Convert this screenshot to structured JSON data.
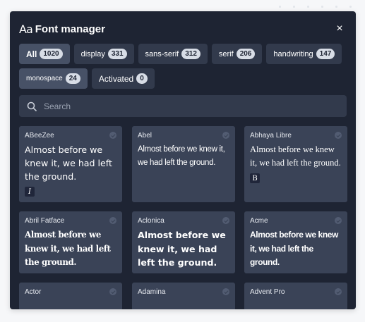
{
  "header": {
    "title_icon": "Aa",
    "title": "Font manager",
    "close_icon": "×"
  },
  "filters": [
    {
      "label": "All",
      "count": "1020"
    },
    {
      "label": "display",
      "count": "331"
    },
    {
      "label": "sans-serif",
      "count": "312"
    },
    {
      "label": "serif",
      "count": "206"
    },
    {
      "label": "handwriting",
      "count": "147"
    },
    {
      "label": "monospace",
      "count": "24"
    },
    {
      "label": "Activated",
      "count": "0"
    }
  ],
  "search": {
    "placeholder": "Search"
  },
  "sample_text": "Almost before we knew it, we had left the ground.",
  "fonts": [
    {
      "name": "ABeeZee",
      "tag": "I"
    },
    {
      "name": "Abel",
      "tag": ""
    },
    {
      "name": "Abhaya Libre",
      "tag": "B"
    },
    {
      "name": "Abril Fatface",
      "tag": ""
    },
    {
      "name": "Aclonica",
      "tag": ""
    },
    {
      "name": "Acme",
      "tag": ""
    },
    {
      "name": "Actor",
      "tag": ""
    },
    {
      "name": "Adamina",
      "tag": ""
    },
    {
      "name": "Advent Pro",
      "tag": ""
    }
  ],
  "colors": {
    "panel": "#1e2433",
    "card": "#3a4357",
    "chip": "#323a4c",
    "badge": "#d8dde6"
  }
}
